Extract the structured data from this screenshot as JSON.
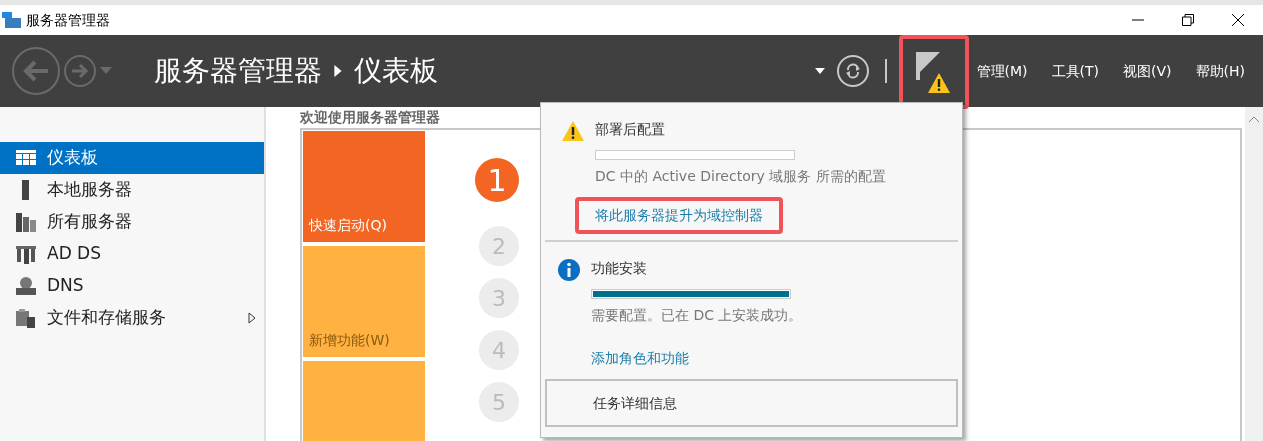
{
  "window": {
    "title": "服务器管理器"
  },
  "header": {
    "breadcrumb": [
      "服务器管理器",
      "仪表板"
    ],
    "flag": {
      "warning": true,
      "highlighted": true
    },
    "menus": [
      "管理(M)",
      "工具(T)",
      "视图(V)",
      "帮助(H)"
    ]
  },
  "sidebar": {
    "items": [
      {
        "label": "仪表板",
        "selected": true,
        "has_children": false
      },
      {
        "label": "本地服务器",
        "selected": false,
        "has_children": false
      },
      {
        "label": "所有服务器",
        "selected": false,
        "has_children": false
      },
      {
        "label": "AD DS",
        "selected": false,
        "has_children": false
      },
      {
        "label": "DNS",
        "selected": false,
        "has_children": false
      },
      {
        "label": "文件和存储服务",
        "selected": false,
        "has_children": true
      }
    ]
  },
  "welcome": {
    "heading": "欢迎使用服务器管理器",
    "tiles": [
      {
        "label": "快速启动(Q)",
        "color": "#f26522"
      },
      {
        "label": "新增功能(W)",
        "color": "#ffb141"
      },
      {
        "color": "#ffb141"
      }
    ],
    "steps": [
      {
        "number": "1",
        "selected": true
      },
      {
        "number": "2",
        "selected": false
      },
      {
        "number": "3",
        "selected": false
      },
      {
        "number": "4",
        "selected": false
      },
      {
        "number": "5",
        "selected": false
      }
    ]
  },
  "notifications": {
    "items": [
      {
        "kind": "warning",
        "title": "部署后配置",
        "level": 0,
        "message": "DC 中的 Active Directory 域服务 所需的配置",
        "link": "将此服务器提升为域控制器",
        "highlighted": true
      },
      {
        "kind": "info",
        "title": "功能安装",
        "level": 1,
        "message": "需要配置。已在 DC 上安装成功。",
        "link": "添加角色和功能",
        "highlighted": false
      }
    ],
    "footer": "任务详细信息"
  }
}
